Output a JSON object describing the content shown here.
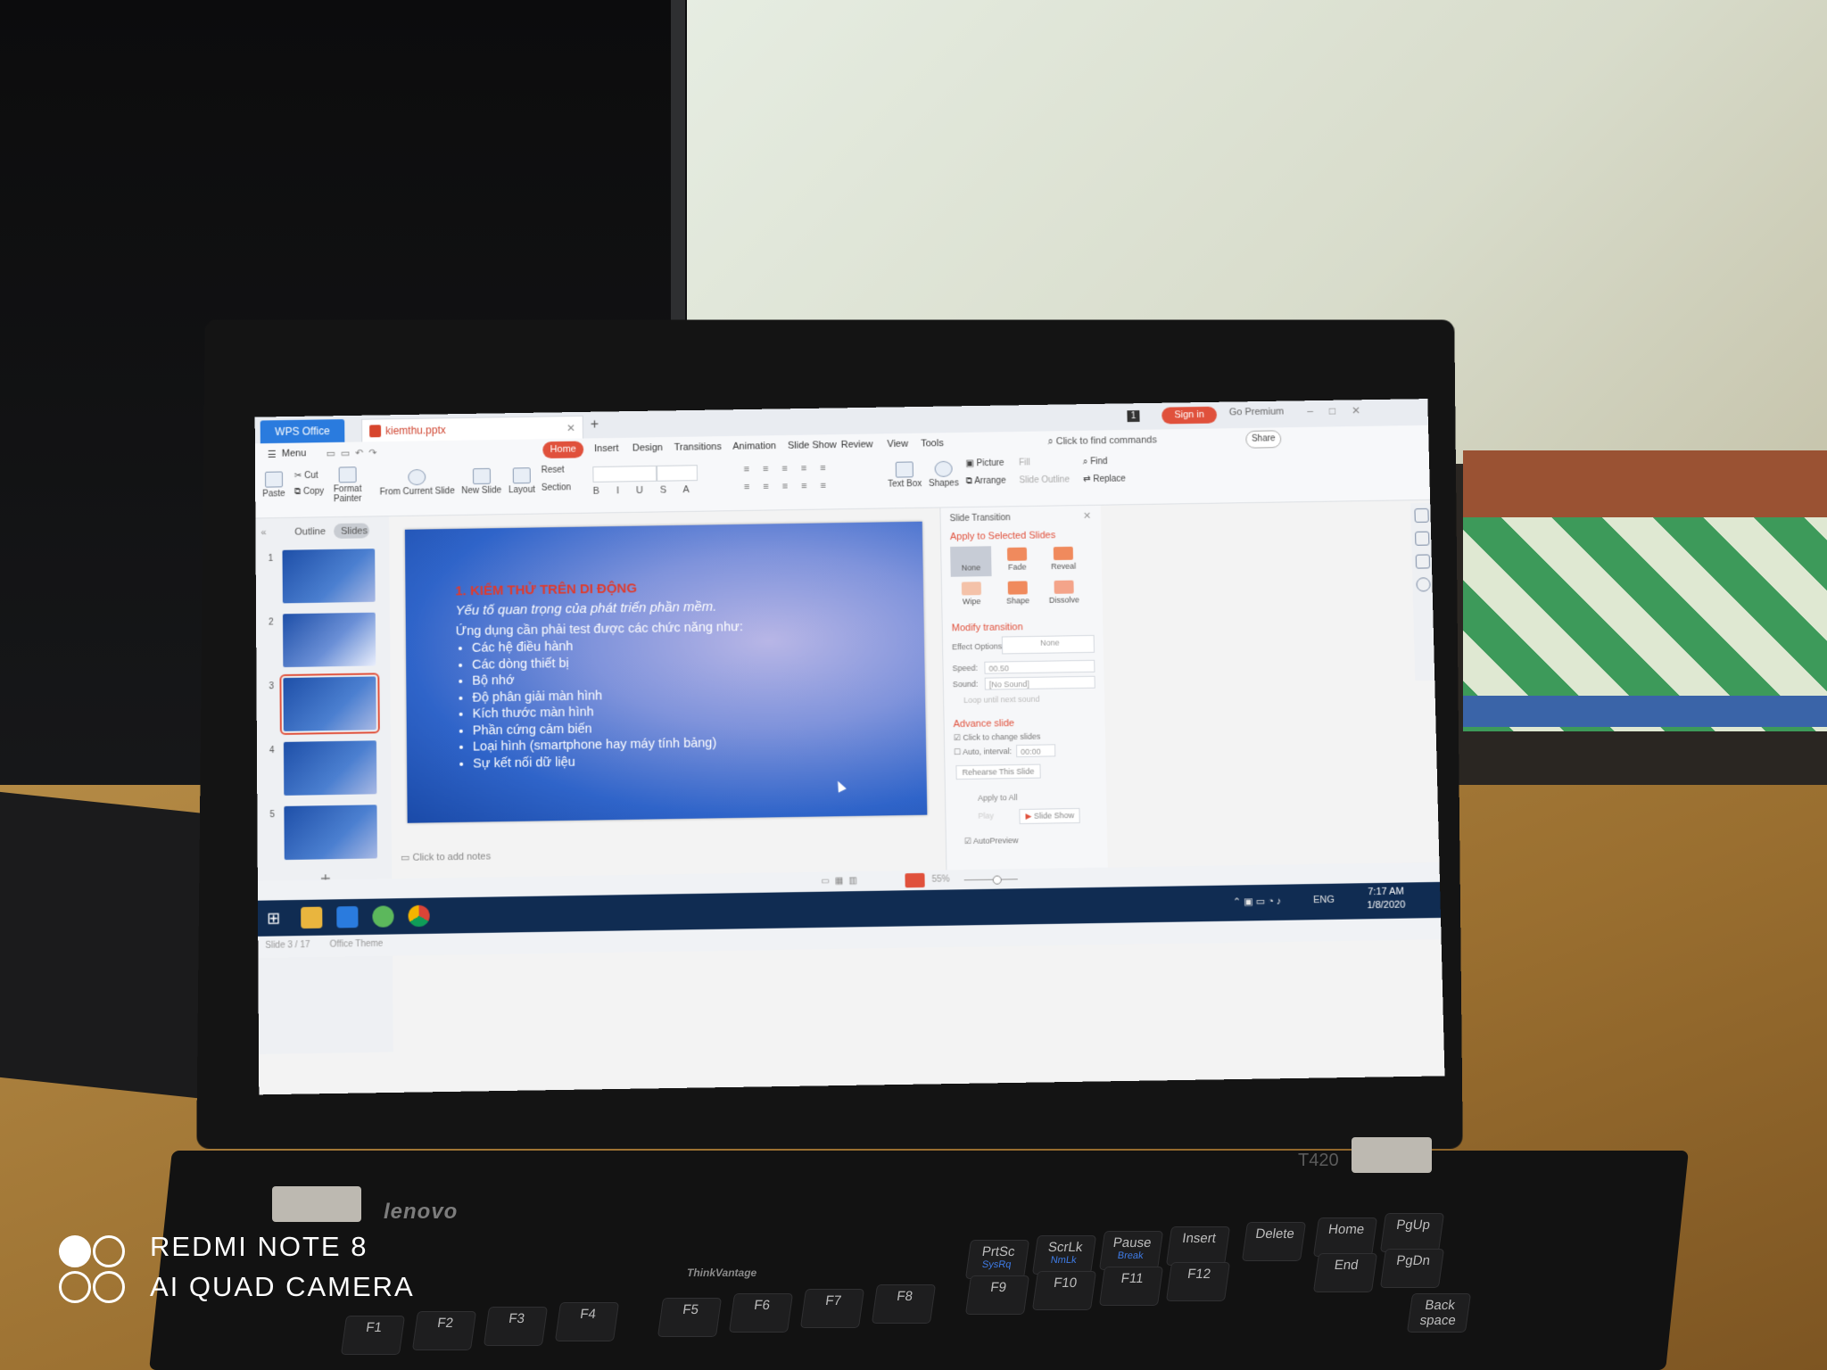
{
  "window": {
    "app_tab": "WPS Office",
    "file_tab": "kiemthu.pptx",
    "badge": "1",
    "sign_in": "Sign in",
    "go_premium": "Go Premium"
  },
  "menu": {
    "menu_label": "Menu",
    "tabs": [
      "Home",
      "Insert",
      "Design",
      "Transitions",
      "Animation",
      "Slide Show",
      "Review",
      "View",
      "Tools"
    ],
    "find_commands": "Click to find commands",
    "share": "Share"
  },
  "ribbon": {
    "paste": "Paste",
    "cut": "Cut",
    "copy": "Copy",
    "format_painter_1": "Format",
    "format_painter_2": "Painter",
    "from_current_slide": "From Current Slide",
    "new_slide": "New Slide",
    "layout": "Layout",
    "reset": "Reset",
    "section": "Section",
    "text_box": "Text Box",
    "shapes": "Shapes",
    "picture": "Picture",
    "arrange": "Arrange",
    "fill": "Fill",
    "slide_outline": "Slide Outline",
    "find": "Find",
    "replace": "Replace"
  },
  "left_pane": {
    "outline_tab": "Outline",
    "slides_tab": "Slides",
    "slide_numbers": [
      "1",
      "2",
      "3",
      "4",
      "5"
    ],
    "selected_slide": 3,
    "add": "+"
  },
  "slide": {
    "title": "1. KIỂM THỬ TRÊN DI ĐỘNG",
    "subtitle": "Yếu tố quan trọng của phát triển phần mềm.",
    "lead": "Ứng dụng cần  phải test được các chức năng như:",
    "bullets": [
      "Các hệ điều hành",
      "Các dòng thiết bị",
      "Bộ nhớ",
      "Độ phân giải màn hình",
      "Kích thước màn hình",
      "Phần cứng cảm biến",
      "Loại hình (smartphone hay máy tính bảng)",
      "Sự kết nối dữ liệu"
    ],
    "notes_placeholder": "Click to add notes"
  },
  "task_pane": {
    "header": "Slide Transition",
    "apply_selected": "Apply to Selected Slides",
    "transitions": [
      "None",
      "Fade",
      "Reveal",
      "Wipe",
      "Shape",
      "Dissolve"
    ],
    "selected_transition": "None",
    "modify_transition": "Modify transition",
    "effect_options_label": "Effect Options:",
    "effect_options_value": "None",
    "speed_label": "Speed:",
    "speed_value": "00.50",
    "sound_label": "Sound:",
    "sound_value": "[No Sound]",
    "loop_label": "Loop until next sound",
    "advance_slide": "Advance slide",
    "on_click": "Click to change slides",
    "auto_label": "Auto, interval:",
    "auto_value": "00:00",
    "rehearse": "Rehearse This Slide",
    "apply_all": "Apply to All",
    "play": "Play",
    "slide_show": "Slide Show",
    "autopreview": "AutoPreview"
  },
  "status": {
    "slide_info": "Slide 3 / 17",
    "theme": "Office Theme",
    "zoom": "55%"
  },
  "taskbar": {
    "language": "ENG",
    "time": "7:17 AM",
    "date": "1/8/2020"
  },
  "hardware": {
    "brand": "lenovo",
    "model": "T420",
    "trackpoint_label": "ThinkVantage",
    "keys": [
      {
        "main": "PrtSc",
        "sub": "SysRq"
      },
      {
        "main": "ScrLk",
        "sub": "NmLk"
      },
      {
        "main": "Pause",
        "sub": "Break"
      },
      {
        "main": "Insert",
        "sub": ""
      },
      {
        "main": "Delete",
        "sub": ""
      },
      {
        "main": "Home",
        "sub": ""
      },
      {
        "main": "PgUp",
        "sub": ""
      },
      {
        "main": "F9",
        "sub": ""
      },
      {
        "main": "F10",
        "sub": ""
      },
      {
        "main": "F11",
        "sub": ""
      },
      {
        "main": "F12",
        "sub": ""
      },
      {
        "main": "End",
        "sub": ""
      },
      {
        "main": "PgDn",
        "sub": ""
      },
      {
        "main": "F1",
        "sub": ""
      },
      {
        "main": "F2",
        "sub": ""
      },
      {
        "main": "F3",
        "sub": ""
      },
      {
        "main": "F4",
        "sub": ""
      },
      {
        "main": "F5",
        "sub": ""
      },
      {
        "main": "F6",
        "sub": ""
      },
      {
        "main": "F7",
        "sub": ""
      },
      {
        "main": "F8",
        "sub": ""
      },
      {
        "main": "Back space",
        "sub": ""
      }
    ]
  },
  "watermark": {
    "line1": "REDMI NOTE 8",
    "line2": "AI QUAD CAMERA"
  },
  "colors": {
    "accent": "#e0513c",
    "wps_blue": "#2a7bde",
    "slide_title": "#e03a2c",
    "taskbar": "#102c52"
  }
}
